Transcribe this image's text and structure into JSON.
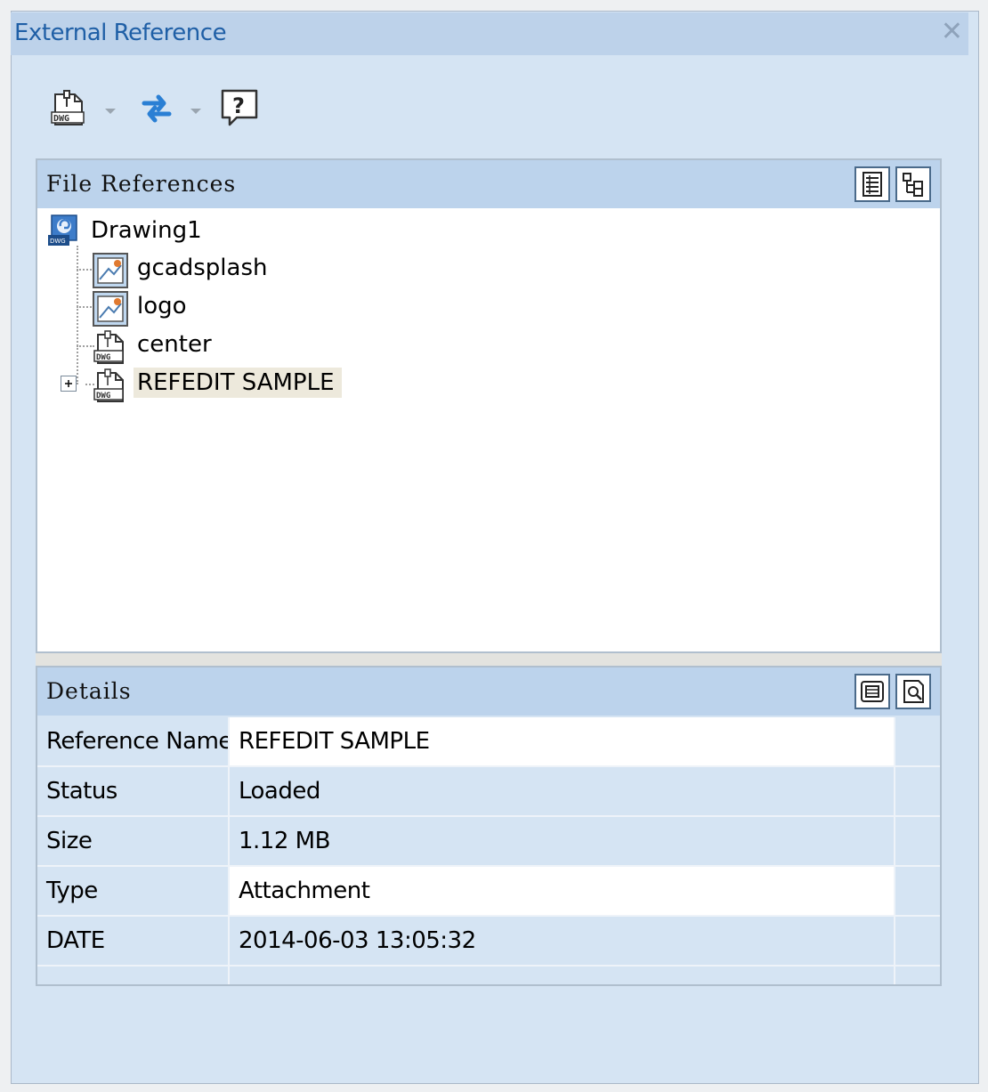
{
  "window": {
    "title": "External Reference",
    "close_label": "✕"
  },
  "toolbar": {
    "attach_icon": "attach-dwg-icon",
    "refresh_icon": "refresh-icon",
    "help_icon": "help-icon",
    "help_glyph": "?"
  },
  "file_references": {
    "header": "File References",
    "list_view_icon": "list-view-icon",
    "tree_view_icon": "tree-view-icon",
    "root": {
      "label": "Drawing1",
      "icon": "dwg-drawing-icon"
    },
    "items": [
      {
        "label": "gcadsplash",
        "icon": "raster-image-icon",
        "selected": false,
        "expandable": false
      },
      {
        "label": "logo",
        "icon": "raster-image-icon",
        "selected": false,
        "expandable": false
      },
      {
        "label": "center",
        "icon": "dwg-xref-icon",
        "selected": false,
        "expandable": false
      },
      {
        "label": "REFEDIT SAMPLE",
        "icon": "dwg-xref-icon",
        "selected": true,
        "expandable": true
      }
    ]
  },
  "details": {
    "header": "Details",
    "details_view_icon": "details-view-icon",
    "preview_view_icon": "preview-view-icon",
    "rows": [
      {
        "name": "Reference Name",
        "value": "REFEDIT SAMPLE",
        "editable": true
      },
      {
        "name": "Status",
        "value": "Loaded",
        "editable": false
      },
      {
        "name": "Size",
        "value": "1.12 MB",
        "editable": false
      },
      {
        "name": "Type",
        "value": "Attachment",
        "editable": true
      },
      {
        "name": "DATE",
        "value": "2014-06-03 13:05:32",
        "editable": false
      }
    ]
  },
  "colors": {
    "panel_bg": "#d5e4f3",
    "header_bg": "#bcd3ec",
    "title_text": "#1f5fa6",
    "selection_bg": "#ede9dc"
  }
}
